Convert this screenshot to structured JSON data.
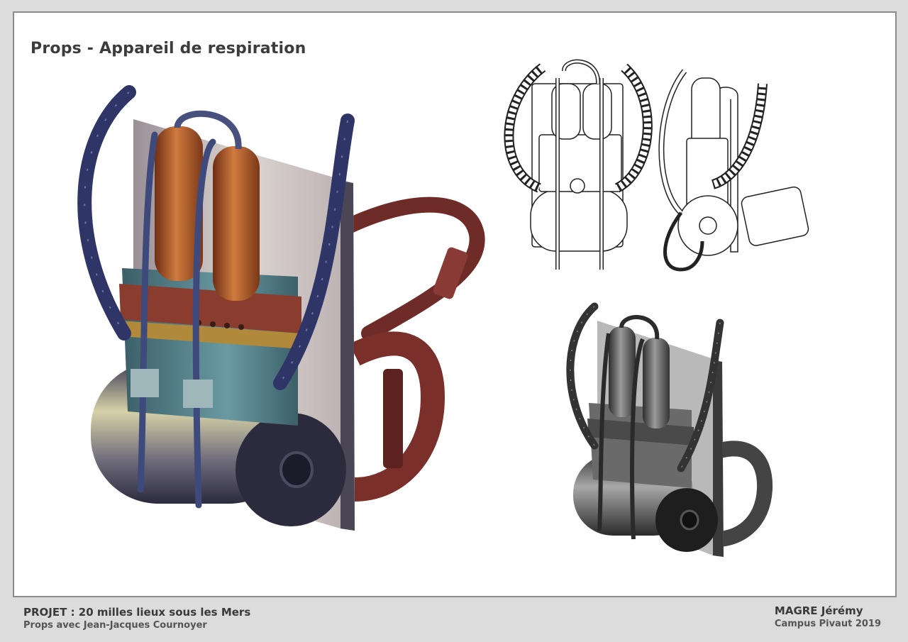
{
  "sheet": {
    "title": "Props - Appareil de respiration"
  },
  "footer": {
    "project": "PROJET : 20 milles lieux sous les Mers",
    "credit": "Props avec Jean-Jacques Cournoyer",
    "author": "MAGRE Jérémy",
    "school": "Campus Pivaut 2019"
  },
  "colors": {
    "copper": "#b8602a",
    "hose": "#2f3566",
    "teal": "#4f7c85",
    "leather": "#7a2f2b",
    "board": "#cfc7c4"
  }
}
